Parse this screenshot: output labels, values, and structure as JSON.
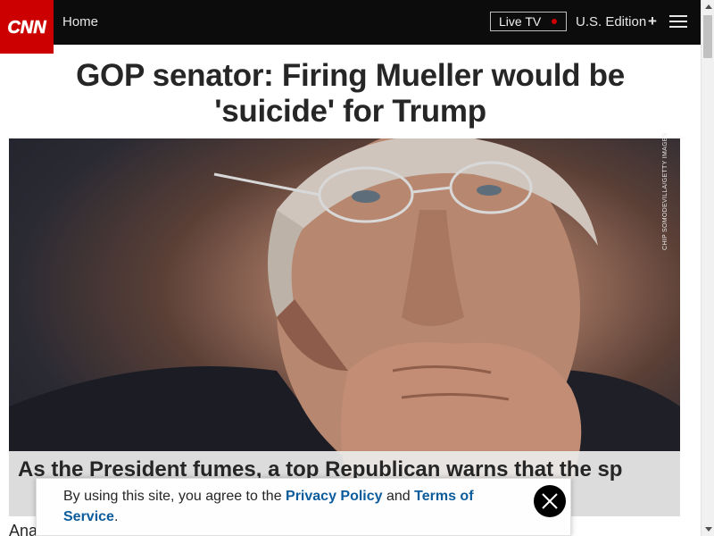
{
  "nav": {
    "home_label": "Home",
    "live_tv_label": "Live TV",
    "edition_label": "U.S. Edition",
    "edition_plus": "+",
    "logo_text": "CNN",
    "menu_icon": "hamburger-menu-icon"
  },
  "article": {
    "headline": "GOP senator: Firing Mueller would be 'suicide' for Trump",
    "image_credit": "CHIP SOMODEVILLA/GETTY IMAGES",
    "caption": "As the President fumes, a top Republican warns that the sp",
    "byline_partial": "Ana"
  },
  "cookie_banner": {
    "text_prefix": "By using this site, you agree to the ",
    "privacy_link": "Privacy Policy",
    "text_middle": " and ",
    "terms_link": "Terms of Service",
    "text_suffix": ".",
    "close_icon": "close-icon"
  },
  "colors": {
    "brand_red": "#cc0000",
    "nav_bg": "#0c0c0c",
    "link_blue": "#0c5c9c"
  }
}
